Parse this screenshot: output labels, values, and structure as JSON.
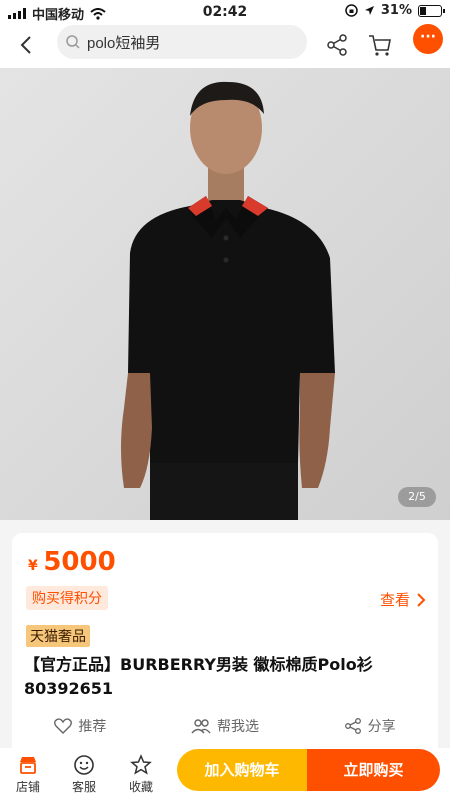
{
  "status_bar": {
    "carrier": "中国移动",
    "time": "02:42",
    "battery": "31%",
    "icons": [
      "signal-icon",
      "wifi-icon",
      "lock-rotation-icon",
      "location-icon",
      "battery-icon"
    ]
  },
  "nav": {
    "search_value": "polo短袖男",
    "more_label": "···",
    "icons": [
      "back-icon",
      "search-icon",
      "share-icon",
      "cart-icon",
      "more-icon"
    ]
  },
  "gallery": {
    "pager": "2/5"
  },
  "product": {
    "currency_symbol": "¥",
    "price": "5000",
    "points_badge": "购买得积分",
    "view_link": "查看",
    "tmall_badge": "天猫奢品",
    "title": "【官方正品】BURBERRY男装 徽标棉质Polo衫 80392651",
    "actions": [
      {
        "icon": "heart-icon",
        "label": "推荐"
      },
      {
        "icon": "people-icon",
        "label": "帮我选"
      },
      {
        "icon": "share-icon",
        "label": "分享"
      }
    ]
  },
  "bottom_bar": {
    "tabs": [
      {
        "icon": "store-icon",
        "label": "店铺"
      },
      {
        "icon": "service-icon",
        "label": "客服"
      },
      {
        "icon": "star-icon",
        "label": "收藏"
      }
    ],
    "add_to_cart": "加入购物车",
    "buy_now": "立即购买"
  },
  "colors": {
    "accent": "#ff5000",
    "cart_button": "#ffb800",
    "tmall_badge": "#f6c67a"
  }
}
